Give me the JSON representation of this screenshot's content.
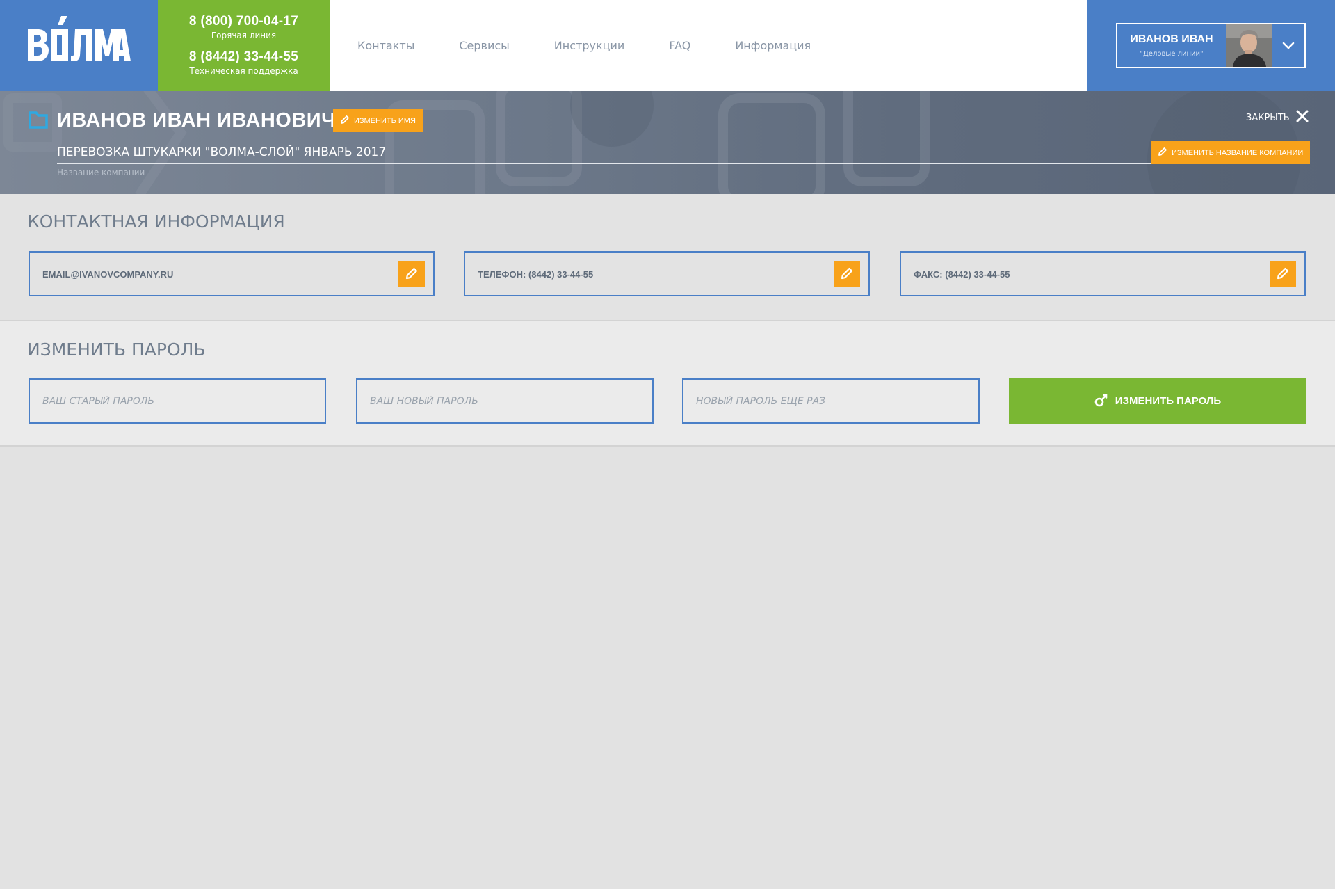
{
  "logo": {
    "text": "ВОЛМА"
  },
  "colors": {
    "brand_blue": "#4a7fc7",
    "brand_green": "#7ab733",
    "accent_orange": "#f8a21a",
    "text_gray": "#6f7c8c"
  },
  "support": {
    "hotline_number": "8 (800) 700-04-17",
    "hotline_caption": "Горячая линия",
    "tech_number": "8 (8442) 33-44-55",
    "tech_caption": "Техническая поддержка"
  },
  "nav": {
    "items": [
      {
        "label": "Контакты"
      },
      {
        "label": "Сервисы"
      },
      {
        "label": "Инструкции"
      },
      {
        "label": "FAQ"
      },
      {
        "label": "Информация"
      }
    ]
  },
  "user": {
    "name": "ИВАНОВ ИВАН",
    "company": "\"Деловые линии\"",
    "avatar_icon": "user-avatar",
    "menu_icon": "chevron-down-icon"
  },
  "profile": {
    "full_name": "ИВАНОВ ИВАН ИВАНОВИЧ",
    "rename_label": "изменить имя",
    "close_label": "ЗАКРЫТЬ",
    "company_name": "ПЕРЕВОЗКА ШТУКАРКИ \"ВОЛМА-СЛОЙ\" ЯНВАРЬ 2017",
    "company_caption": "Название компании",
    "rename_company_label": "изменить название компании"
  },
  "contacts": {
    "title": "КОНТАКТНАЯ ИНФОРМАЦИЯ",
    "email": "EMAIL@IVANOVCOMPANY.RU",
    "phone": "ТЕЛЕФОН: (8442) 33-44-55",
    "fax": "ФАКС: (8442) 33-44-55"
  },
  "password": {
    "title": "ИЗМЕНИТЬ ПАРОЛЬ",
    "old_placeholder": "ВАШ СТАРЫЙ ПАРОЛЬ",
    "new_placeholder": "ВАШ НОВЫЙ ПАРОЛЬ",
    "repeat_placeholder": "НОВЫЙ ПАРОЛЬ ЕЩЕ РАЗ",
    "submit_label": "ИЗМЕНИТЬ ПАРОЛЬ"
  }
}
